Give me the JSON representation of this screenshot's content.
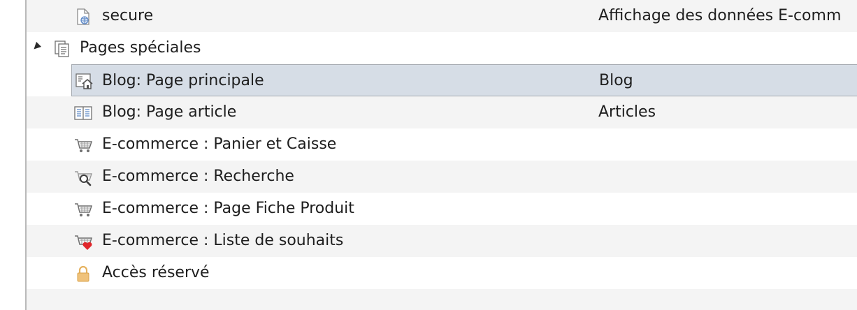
{
  "tree": {
    "rows": [
      {
        "label": "secure",
        "description": "Affichage des données E-comm",
        "icon": "secure-page-icon"
      },
      {
        "label": "Pages spéciales",
        "description": "",
        "icon": "pages-folder-icon",
        "expanded": true
      },
      {
        "label": "Blog: Page principale",
        "description": "Blog",
        "icon": "blog-home-icon",
        "selected": true
      },
      {
        "label": "Blog: Page article",
        "description": "Articles",
        "icon": "blog-article-icon"
      },
      {
        "label": "E-commerce : Panier et Caisse",
        "description": "",
        "icon": "cart-icon"
      },
      {
        "label": "E-commerce : Recherche",
        "description": "",
        "icon": "cart-search-icon"
      },
      {
        "label": "E-commerce : Page Fiche Produit",
        "description": "",
        "icon": "cart-icon"
      },
      {
        "label": "E-commerce : Liste de souhaits",
        "description": "",
        "icon": "cart-heart-icon"
      },
      {
        "label": "Accès réservé",
        "description": "",
        "icon": "lock-icon"
      }
    ]
  },
  "colors": {
    "selected_bg": "#d6dde6",
    "alt_row_bg": "#f4f4f4",
    "lock": "#e6b25f",
    "heart": "#e0262b",
    "globe": "#5b86c5"
  }
}
